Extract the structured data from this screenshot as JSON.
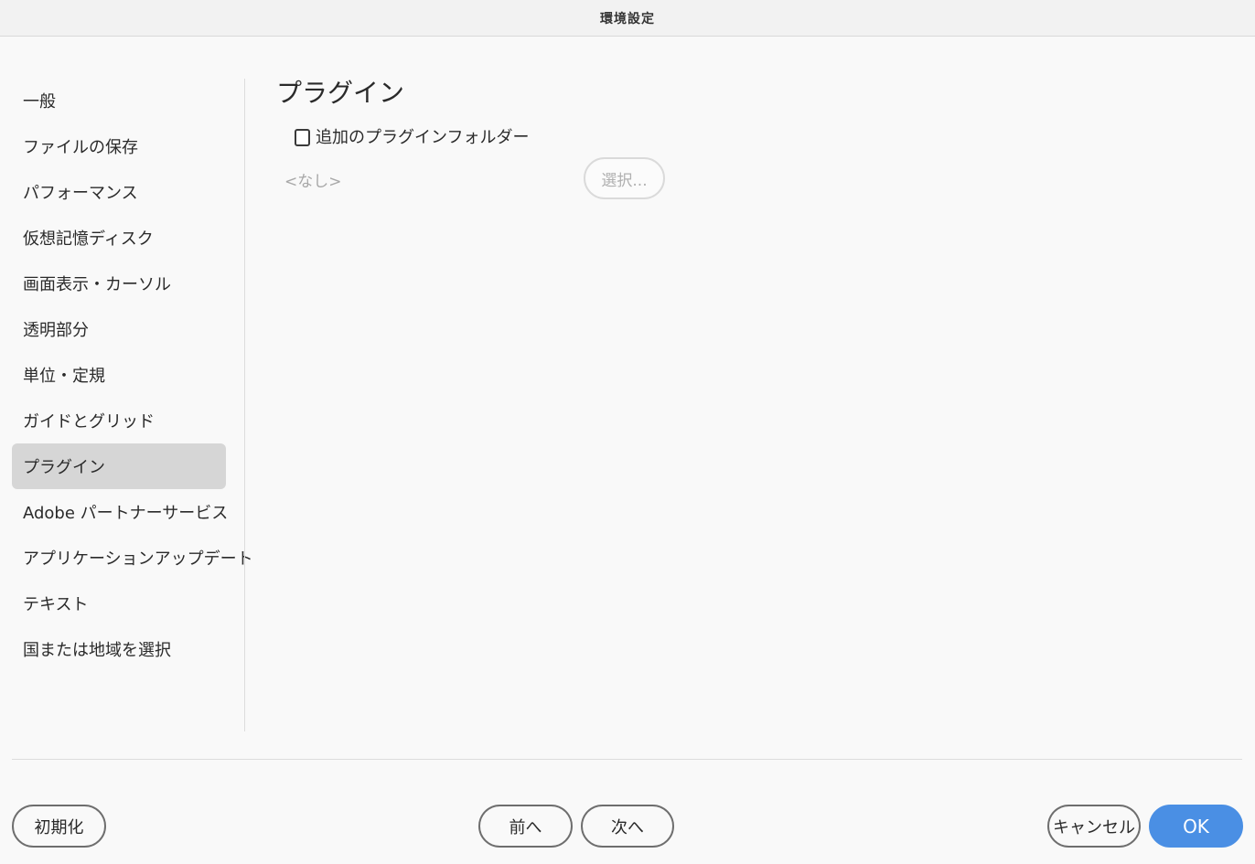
{
  "window": {
    "title": "環境設定"
  },
  "sidebar": {
    "items": [
      {
        "label": "一般"
      },
      {
        "label": "ファイルの保存"
      },
      {
        "label": "パフォーマンス"
      },
      {
        "label": "仮想記憶ディスク"
      },
      {
        "label": "画面表示・カーソル"
      },
      {
        "label": "透明部分"
      },
      {
        "label": "単位・定規"
      },
      {
        "label": "ガイドとグリッド"
      },
      {
        "label": "プラグイン"
      },
      {
        "label": "Adobe パートナーサービス"
      },
      {
        "label": "アプリケーションアップデート"
      },
      {
        "label": "テキスト"
      },
      {
        "label": "国または地域を選択"
      }
    ],
    "selected": "プラグイン"
  },
  "panel": {
    "heading": "プラグイン",
    "additional_folder_label": "追加のプラグインフォルダー",
    "additional_folder_checked": false,
    "folder_path": "<なし>",
    "choose_label": "選択..."
  },
  "footer": {
    "reset_label": "初期化",
    "prev_label": "前へ",
    "next_label": "次へ",
    "cancel_label": "キャンセル",
    "ok_label": "OK"
  },
  "colors": {
    "accent": "#4a8fe4",
    "selected_bg": "#d6d6d6"
  }
}
